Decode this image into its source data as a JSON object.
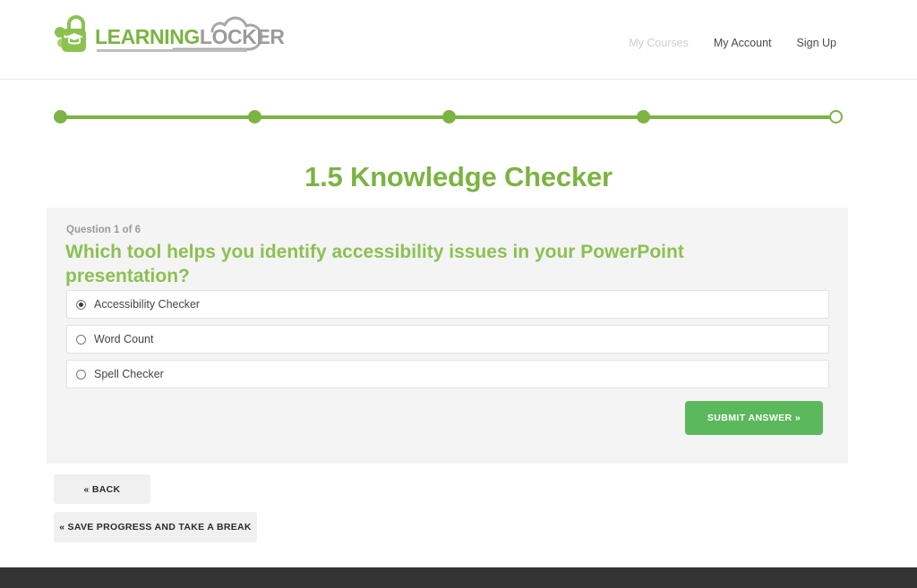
{
  "header": {
    "logo": {
      "icon": "padlock-graduation-cap-logo",
      "text_primary": "LEARNING",
      "text_secondary": "LOCKER",
      "color_primary": "#7cb342",
      "color_secondary": "#9b9b9b"
    },
    "nav": [
      {
        "label": "My Courses",
        "state": "muted"
      },
      {
        "label": "My Account",
        "state": "normal"
      },
      {
        "label": "Sign Up",
        "state": "normal"
      }
    ]
  },
  "progress": {
    "steps": 5,
    "completed": 4,
    "color": "#7cb342",
    "dots": [
      "filled",
      "filled",
      "filled",
      "filled",
      "empty"
    ]
  },
  "page": {
    "title": "1.5 Knowledge Checker",
    "title_color": "#7cb342"
  },
  "question": {
    "counter": "Question 1 of 6",
    "number": 1,
    "total": 6,
    "text": "Which tool helps you identify accessibility issues in your PowerPoint presentation?",
    "text_color": "#8cc152",
    "options": [
      {
        "label": "Accessibility Checker",
        "selected": true
      },
      {
        "label": "Word Count",
        "selected": false
      },
      {
        "label": "Spell Checker",
        "selected": false
      }
    ],
    "submit_label": "SUBMIT ANSWER »",
    "submit_color": "#5cb85c"
  },
  "actions": {
    "back_label": "« BACK",
    "save_label": "« SAVE PROGRESS AND TAKE A BREAK"
  },
  "footer": {
    "color": "#333333"
  }
}
